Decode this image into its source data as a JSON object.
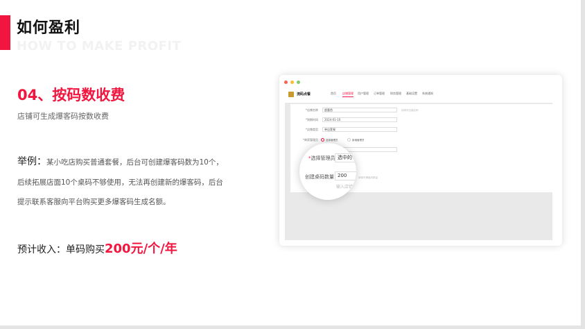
{
  "header": {
    "title": "如何盈利",
    "subtitle_en": "HOW TO MAKE PROFIT"
  },
  "section": {
    "title": "04、按码数收费",
    "description": "店铺可生成爆客码按数收费"
  },
  "example": {
    "label": "举例：",
    "line1": "某小吃店购买普通套餐，后台可创建爆客码数为10个，",
    "line2": "后续拓展店面10个桌码不够使用，无法再创建新的爆客码，后台",
    "line3": "提示联系客服向平台购买更多爆客码生成名额。"
  },
  "income": {
    "label": "预计收入：单码购买",
    "value": "200元/个/年"
  },
  "mock_app": {
    "app_name": "流码点餐",
    "nav": [
      "首页",
      "店铺管理",
      "用户管理",
      "订单管理",
      "财务管理",
      "基础设置",
      "系统通知"
    ],
    "active_nav_index": 1,
    "form": {
      "row1_label": "*店铺名称",
      "row1_value": "超重首",
      "row1_hint": "请填写店铺名称",
      "row2_label": "*到期时间",
      "row2_value": "2024-01-10",
      "row3_label": "*店铺类型",
      "row3_value": "单店套餐",
      "row4_label": "*商家管理员",
      "radio1": "选择管理员",
      "radio2": "新增管理员",
      "row5_label": "*选",
      "hint2": "请填写爆客码数量"
    },
    "lens": {
      "req_mark": "*",
      "label1": "选择管理员",
      "value1": "选中的↓",
      "label2": "创建桌码数量",
      "value2": "200",
      "hint": "输入店铲"
    }
  },
  "colors": {
    "accent": "#f0163f",
    "dot_red": "#ff5f57",
    "dot_yellow": "#febc2e",
    "dot_green": "#84c96f"
  }
}
